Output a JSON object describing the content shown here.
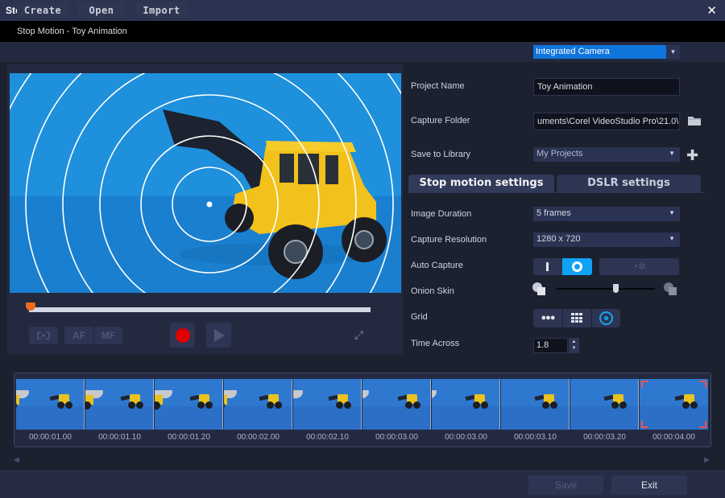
{
  "window": {
    "title": "Stop Motion",
    "close_icon": "close-icon",
    "subtitle": "Stop Motion - Toy Animation"
  },
  "toolbar": {
    "create_label": "Create",
    "open_label": "Open",
    "import_label": "Import",
    "camera_source": "Integrated Camera"
  },
  "preview": {
    "scrub_position": 0,
    "controls": {
      "focus_icon": "focus-frame-icon",
      "af_label": "AF",
      "mf_label": "MF",
      "record_icon": "record-icon",
      "play_icon": "play-icon",
      "expand_icon": "expand-icon"
    }
  },
  "settings": {
    "project_name_label": "Project Name",
    "project_name_value": "Toy Animation",
    "capture_folder_label": "Capture Folder",
    "capture_folder_value": "uments\\Corel VideoStudio Pro\\21.0\\",
    "save_to_library_label": "Save to Library",
    "save_to_library_value": "My Projects",
    "tabs": [
      {
        "label": "Stop motion settings",
        "active": true
      },
      {
        "label": "DSLR settings",
        "active": false
      }
    ],
    "image_duration_label": "Image Duration",
    "image_duration_value": "5 frames",
    "capture_resolution_label": "Capture Resolution",
    "capture_resolution_value": "1280 x 720",
    "auto_capture_label": "Auto Capture",
    "auto_capture_mode": "on",
    "onion_skin_label": "Onion Skin",
    "onion_skin_level_percent": 60,
    "grid_label": "Grid",
    "grid_selected": "circle",
    "time_across_label": "Time Across",
    "time_across_value": "1.8"
  },
  "timeline": {
    "frames": [
      {
        "timestamp": "00:00:01.00",
        "selected": false
      },
      {
        "timestamp": "00:00:01.10",
        "selected": false
      },
      {
        "timestamp": "00:00:01.20",
        "selected": false
      },
      {
        "timestamp": "00:00:02.00",
        "selected": false
      },
      {
        "timestamp": "00:00:02.10",
        "selected": false
      },
      {
        "timestamp": "00:00:03.00",
        "selected": false
      },
      {
        "timestamp": "00:00:03.00",
        "selected": false
      },
      {
        "timestamp": "00:00:03.10",
        "selected": false
      },
      {
        "timestamp": "00:00:03.20",
        "selected": false
      },
      {
        "timestamp": "00:00:04.00",
        "selected": true
      }
    ]
  },
  "footer": {
    "save_label": "Save",
    "exit_label": "Exit"
  },
  "colors": {
    "accent_blue": "#10a3f5",
    "record_red": "#e00000",
    "scrub_orange": "#f06a1b",
    "selection_red": "#f25050"
  }
}
